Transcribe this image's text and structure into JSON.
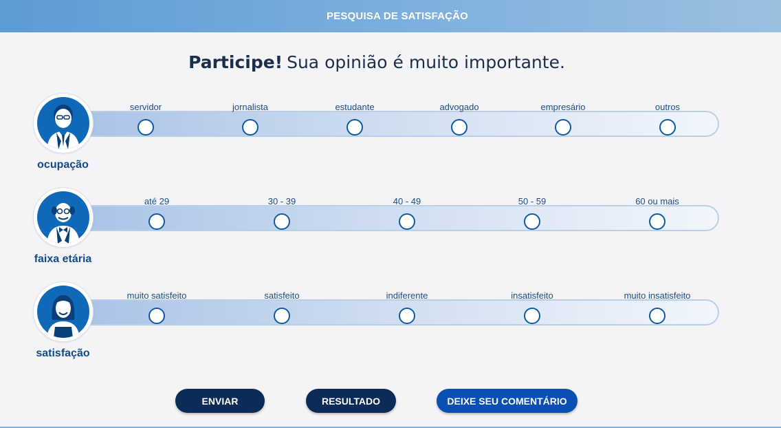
{
  "header": {
    "title": "PESQUISA DE SATISFAÇÃO"
  },
  "headline": {
    "bold": "Participe!",
    "rest": "Sua opinião é muito importante."
  },
  "rows": [
    {
      "label": "ocupação",
      "icon": "man-with-glasses-icon",
      "options": [
        "servidor",
        "jornalista",
        "estudante",
        "advogado",
        "empresário",
        "outros"
      ]
    },
    {
      "label": "faixa etária",
      "icon": "elderly-man-icon",
      "options": [
        "até 29",
        "30 - 39",
        "40 - 49",
        "50 - 59",
        "60 ou mais"
      ]
    },
    {
      "label": "satisfação",
      "icon": "smiling-woman-icon",
      "options": [
        "muito satisfeito",
        "satisfeito",
        "indiferente",
        "insatisfeito",
        "muito insatisfeito"
      ]
    }
  ],
  "buttons": {
    "send": "ENVIAR",
    "result": "RESULTADO",
    "comment": "DEIXE SEU COMENTÁRIO"
  },
  "colors": {
    "header": "#7fb0dd",
    "accent": "#0f68b8",
    "button_dark": "#0d2b57",
    "button_blue": "#0c4fb2"
  }
}
